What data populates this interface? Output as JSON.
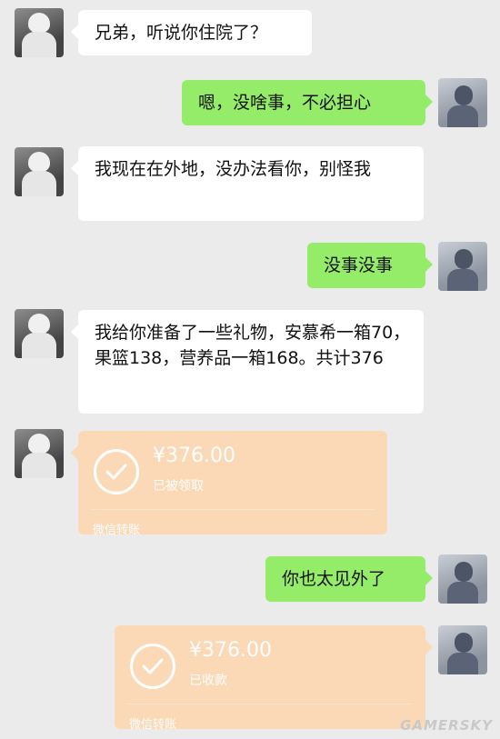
{
  "messages": [
    {
      "text": "兄弟，听说你住院了？"
    },
    {
      "text": "嗯，没啥事，不必担心"
    },
    {
      "text": "我现在在外地，没办法看你，别怪我"
    },
    {
      "text": "没事没事"
    },
    {
      "text": "我给你准备了一些礼物，安慕希一箱70，果篮138，营养品一箱168。共计376"
    },
    {
      "amount": "¥376.00",
      "status": "已被领取",
      "footer": "微信转账",
      "icon": "check-icon"
    },
    {
      "text": "你也太见外了"
    },
    {
      "amount": "¥376.00",
      "status": "已收款",
      "footer": "微信转账",
      "icon": "check-icon"
    }
  ],
  "watermark": "GAMERSKY",
  "colors": {
    "background": "#ebebeb",
    "incoming_bubble": "#ffffff",
    "outgoing_bubble": "#95ec69",
    "transfer_card": "#fbd9b6"
  }
}
